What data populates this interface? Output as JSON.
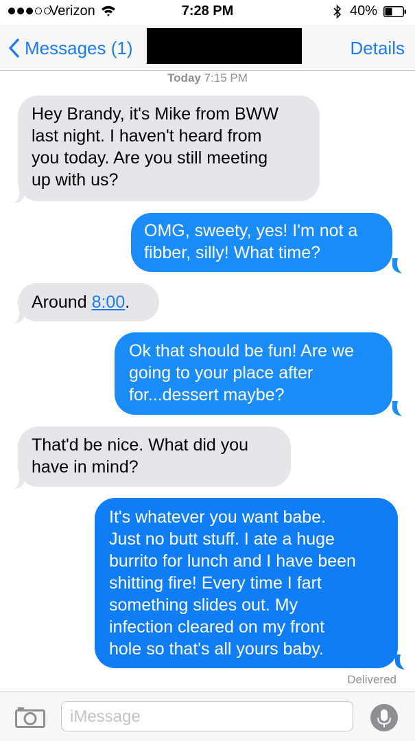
{
  "status_bar": {
    "carrier": "Verizon",
    "time": "7:28 PM",
    "battery_percent": "40%",
    "battery_level": 0.4,
    "signal_bars": 3
  },
  "nav": {
    "back_label": "Messages (1)",
    "details_label": "Details"
  },
  "conversation": {
    "timestamp_day": "Today",
    "timestamp_time": "7:15 PM",
    "messages": [
      {
        "from": "them",
        "lines": [
          "Hey Brandy, it's Mike from BWW",
          "last night. I haven't heard from",
          "you today. Are you still meeting",
          "up with us?"
        ]
      },
      {
        "from": "me",
        "lines": [
          "OMG, sweety, yes! I'm not a",
          "fibber, silly! What time?"
        ]
      },
      {
        "from": "them",
        "text_prefix": "Around ",
        "link": "8:00",
        "text_suffix": "."
      },
      {
        "from": "me",
        "lines": [
          "Ok that should be fun! Are we",
          "going to your place after",
          "for...dessert maybe?"
        ]
      },
      {
        "from": "them",
        "lines": [
          "That'd be nice. What did you",
          "have in mind?"
        ]
      },
      {
        "from": "me",
        "lines": [
          "It's whatever you want babe.",
          "Just no butt stuff. I ate a huge",
          "burrito for lunch and I have been",
          "shitting fire! Every time I fart",
          "something slides out. My",
          "infection cleared on my front",
          "hole so that's all yours baby."
        ]
      }
    ],
    "delivered_label": "Delivered"
  },
  "input": {
    "placeholder": "iMessage"
  },
  "colors": {
    "accent": "#1b7cf2",
    "outgoing_bubble": "#1a8cf7",
    "incoming_bubble": "#e5e5ea"
  }
}
